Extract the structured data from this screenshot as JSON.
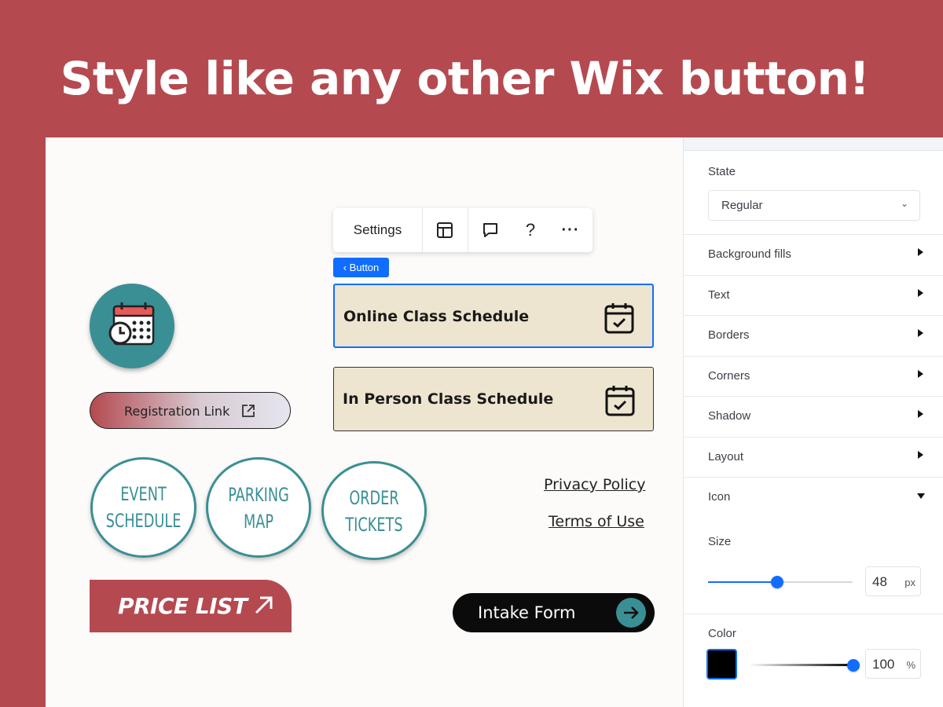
{
  "banner": {
    "title": "Style like any other Wix button!"
  },
  "toolbar": {
    "settings_label": "Settings",
    "layout_icon": "layout-icon",
    "comment_icon": "comment-icon",
    "help_label": "?",
    "more_label": "···"
  },
  "selection_tag": {
    "label": "‹ Button"
  },
  "canvas": {
    "schedule_buttons": [
      {
        "label": "Online Class Schedule",
        "icon": "calendar-check-icon",
        "selected": true
      },
      {
        "label": "In Person Class Schedule",
        "icon": "calendar-check-icon",
        "selected": false
      }
    ],
    "calendar_button": {
      "icon": "calendar-clock-icon"
    },
    "registration_button": {
      "label": "Registration Link",
      "icon": "external-link-icon"
    },
    "circle_buttons": [
      {
        "line1": "EVENT",
        "line2": "SCHEDULE"
      },
      {
        "line1": "PARKING",
        "line2": "MAP"
      },
      {
        "line1": "ORDER",
        "line2": "TICKETS"
      }
    ],
    "links": {
      "privacy": "Privacy Policy",
      "terms": "Terms of Use"
    },
    "price_button": {
      "label": "PRICE LIST",
      "icon": "arrow-up-right-icon"
    },
    "intake_button": {
      "label": "Intake Form",
      "icon": "arrow-right-circle-icon"
    }
  },
  "panel": {
    "state": {
      "label": "State",
      "value": "Regular"
    },
    "sections": [
      "Background fills",
      "Text",
      "Borders",
      "Corners",
      "Shadow",
      "Layout",
      "Icon"
    ],
    "icon_size": {
      "label": "Size",
      "value": "48",
      "unit": "px",
      "level": 0.48
    },
    "icon_color": {
      "label": "Color",
      "swatch": "#000000",
      "opacity": "100",
      "unit": "%",
      "level": 1.0
    }
  },
  "colors": {
    "brand_red": "#b44a50",
    "teal": "#3a8f94",
    "wix_blue": "#116dff",
    "cream": "#ede5cf"
  }
}
